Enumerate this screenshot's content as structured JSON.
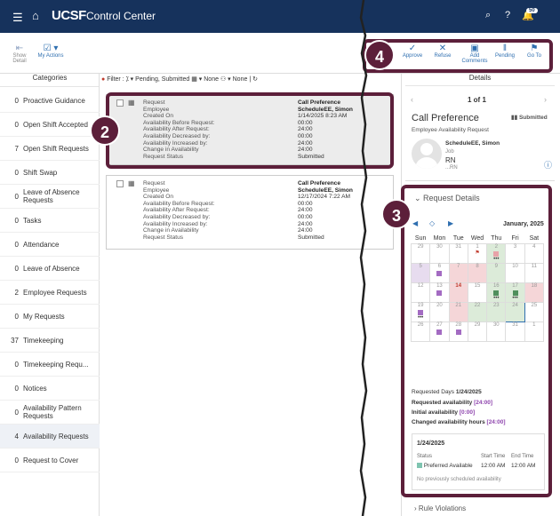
{
  "header": {
    "logo": "UCSF",
    "title": "Control Center",
    "badge": "50"
  },
  "toolbar": {
    "show_detail": "Show Detail",
    "my_actions": "My Actions",
    "approve": "Approve",
    "refuse": "Refuse",
    "add_comments": "Add Comments",
    "pending": "Pending",
    "goto": "Go To"
  },
  "categories": {
    "header": "Categories",
    "items": [
      {
        "count": "0",
        "label": "Proactive Guidance"
      },
      {
        "count": "0",
        "label": "Open Shift Accepted"
      },
      {
        "count": "7",
        "label": "Open Shift Requests"
      },
      {
        "count": "0",
        "label": "Shift Swap"
      },
      {
        "count": "0",
        "label": "Leave of Absence Requests"
      },
      {
        "count": "0",
        "label": "Tasks"
      },
      {
        "count": "0",
        "label": "Attendance"
      },
      {
        "count": "0",
        "label": "Leave of Absence"
      },
      {
        "count": "2",
        "label": "Employee Requests"
      },
      {
        "count": "0",
        "label": "My Requests"
      },
      {
        "count": "37",
        "label": "Timekeeping"
      },
      {
        "count": "0",
        "label": "Timekeeping Requ..."
      },
      {
        "count": "0",
        "label": "Notices"
      },
      {
        "count": "0",
        "label": "Availability Pattern Requests"
      },
      {
        "count": "4",
        "label": "Availability Requests"
      },
      {
        "count": "0",
        "label": "Request to Cover"
      }
    ]
  },
  "filter": {
    "label": "Filter :",
    "status": "Pending, Submitted",
    "date": "None",
    "group": "None"
  },
  "cards": [
    {
      "rows": [
        {
          "k": "Request",
          "v": "Call Preference",
          "b": true
        },
        {
          "k": "Employee",
          "v": "ScheduleEE, Simon",
          "b": true
        },
        {
          "k": "Created On",
          "v": "1/14/2025 8:23 AM"
        },
        {
          "k": "Availability Before Request:",
          "v": "00:00"
        },
        {
          "k": "Availability After Request:",
          "v": "24:00"
        },
        {
          "k": "Availability Decreased by:",
          "v": "00:00"
        },
        {
          "k": "Availability Increased by:",
          "v": "24:00"
        },
        {
          "k": "Change in Availability",
          "v": "24:00"
        },
        {
          "k": "Request Status",
          "v": "Submitted"
        }
      ]
    },
    {
      "rows": [
        {
          "k": "Request",
          "v": "Call Preference",
          "b": true
        },
        {
          "k": "Employee",
          "v": "ScheduleEE, Simon",
          "b": true
        },
        {
          "k": "Created On",
          "v": "12/17/2024 7:22 AM"
        },
        {
          "k": "Availability Before Request:",
          "v": "00:00"
        },
        {
          "k": "Availability After Request:",
          "v": "24:00"
        },
        {
          "k": "Availability Decreased by:",
          "v": "00:00"
        },
        {
          "k": "Availability Increased by:",
          "v": "24:00"
        },
        {
          "k": "Change in Availability",
          "v": "24:00"
        },
        {
          "k": "Request Status",
          "v": "Submitted"
        }
      ]
    }
  ],
  "details": {
    "header": "Details",
    "pager": "1 of 1",
    "title": "Call Preference",
    "status": "Submitted",
    "subtitle": "Employee Availability Request",
    "emp_name": "ScheduleEE, Simon",
    "emp_job": "Job",
    "emp_role": "RN",
    "emp_extra": "...RN",
    "section": "Request Details",
    "month": "January, 2025",
    "weekdays": [
      "Sun",
      "Mon",
      "Tue",
      "Wed",
      "Thu",
      "Fri",
      "Sat"
    ],
    "weeks": [
      [
        "29",
        "30",
        "31",
        "1",
        "2",
        "3",
        "4"
      ],
      [
        "5",
        "6",
        "7",
        "8",
        "9",
        "10",
        "11"
      ],
      [
        "12",
        "13",
        "14",
        "15",
        "16",
        "17",
        "18"
      ],
      [
        "19",
        "20",
        "21",
        "22",
        "23",
        "24",
        "25"
      ],
      [
        "26",
        "27",
        "28",
        "29",
        "30",
        "31",
        "1"
      ]
    ],
    "requested_days_label": "Requested Days",
    "requested_days": "1/24/2025",
    "req_avail_label": "Requested availability",
    "req_avail": "[24:00]",
    "init_avail_label": "Initial availability",
    "init_avail": "[0:00]",
    "changed_label": "Changed availability hours",
    "changed": "[24:00]",
    "box_date": "1/24/2025",
    "box_status_h": "Status",
    "box_start_h": "Start Time",
    "box_end_h": "End Time",
    "box_status": "Preferred Available",
    "box_start": "12:00 AM",
    "box_end": "12:00 AM",
    "box_note": "No previously scheduled availability",
    "rule_violations": "Rule Violations"
  },
  "callouts": [
    "2",
    "3",
    "4"
  ]
}
